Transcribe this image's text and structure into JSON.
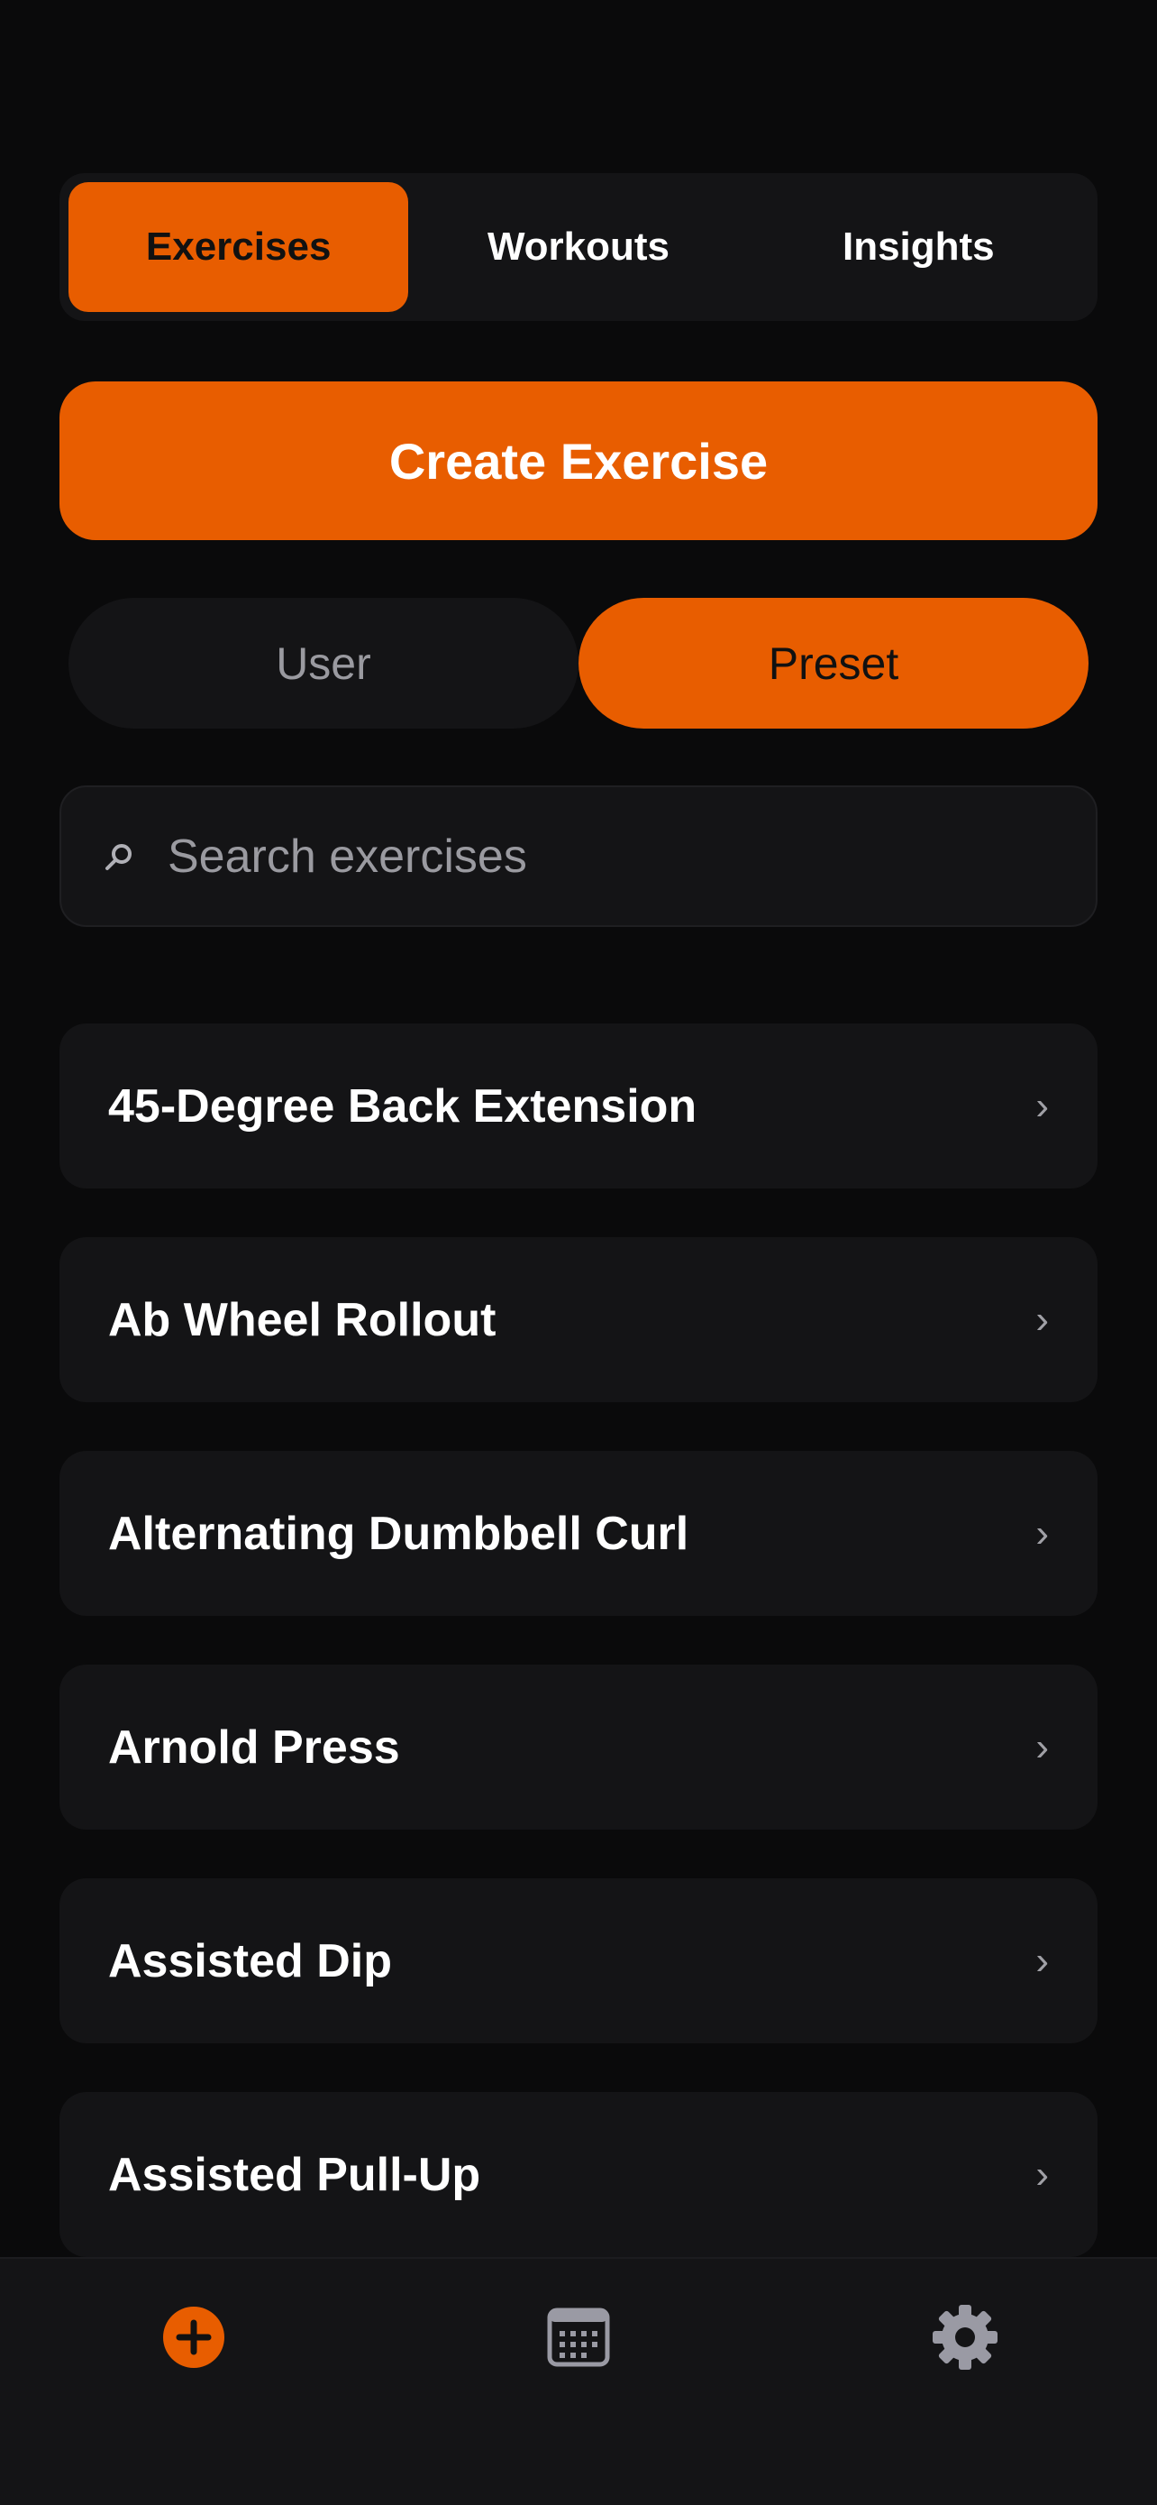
{
  "top_tabs": {
    "items": [
      {
        "label": "Exercises",
        "active": true
      },
      {
        "label": "Workouts",
        "active": false
      },
      {
        "label": "Insights",
        "active": false
      }
    ]
  },
  "create_button": {
    "label": "Create Exercise"
  },
  "source_toggle": {
    "user_label": "User",
    "preset_label": "Preset",
    "selected": "Preset"
  },
  "search": {
    "placeholder": "Search exercises",
    "value": "",
    "icon": "search-icon"
  },
  "exercises": [
    {
      "label": "45-Degree Back Extension"
    },
    {
      "label": "Ab Wheel Rollout"
    },
    {
      "label": "Alternating Dumbbell Curl"
    },
    {
      "label": "Arnold Press"
    },
    {
      "label": "Assisted Dip"
    },
    {
      "label": "Assisted Pull-Up"
    }
  ],
  "chevron_glyph": "›",
  "bottom_bar": {
    "icons": [
      "add-circle-icon",
      "calendar-icon",
      "gear-icon"
    ],
    "active": "add-circle-icon"
  },
  "colors": {
    "accent": "#e85d00",
    "background": "#0a0a0b",
    "surface": "#141416",
    "muted_text": "#9a9aa0"
  }
}
